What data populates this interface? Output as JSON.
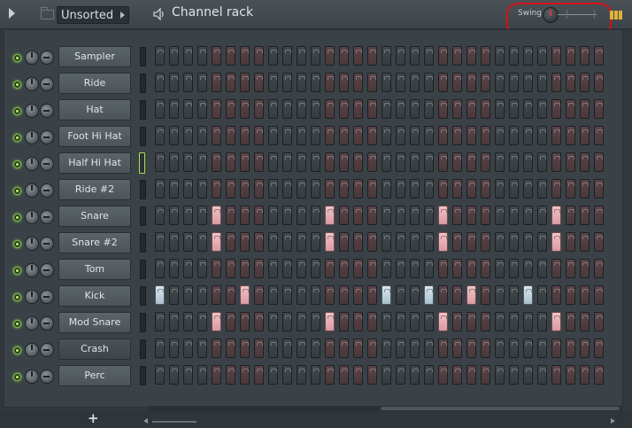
{
  "window": {
    "group_select": "Unsorted",
    "title": "Channel rack",
    "swing_label": "Swing"
  },
  "colors": {
    "background": "#31383d",
    "step_off_gray": "#3b4246",
    "step_off_red": "#503d40",
    "step_on_pink": "#e7b1b7",
    "step_on_blue": "#c3d4df",
    "led": "#8fe24a",
    "highlight": "#d4121a"
  },
  "step_count": 32,
  "channels": [
    {
      "name": "Sampler",
      "active_steps": [],
      "on_color": "pink",
      "selected": false
    },
    {
      "name": "Ride",
      "active_steps": [],
      "on_color": "pink",
      "selected": false
    },
    {
      "name": "Hat",
      "active_steps": [],
      "on_color": "pink",
      "selected": false
    },
    {
      "name": "Foot Hi Hat",
      "active_steps": [],
      "on_color": "pink",
      "selected": false
    },
    {
      "name": "Half Hi Hat",
      "active_steps": [],
      "on_color": "pink",
      "selected": true
    },
    {
      "name": "Ride #2",
      "active_steps": [],
      "on_color": "pink",
      "selected": false
    },
    {
      "name": "Snare",
      "active_steps": [
        5,
        13,
        21,
        29
      ],
      "on_color": "pink",
      "selected": false
    },
    {
      "name": "Snare #2",
      "active_steps": [
        5,
        13,
        21,
        29
      ],
      "on_color": "pink",
      "selected": false
    },
    {
      "name": "Tom",
      "active_steps": [],
      "on_color": "pink",
      "selected": false
    },
    {
      "name": "Kick",
      "active_steps": [
        1,
        7,
        17,
        20,
        23,
        27
      ],
      "on_color": "mixed",
      "selected": false,
      "step_colors": {
        "1": "blue",
        "7": "pink",
        "17": "blue",
        "20": "blue",
        "23": "pink",
        "27": "blue"
      }
    },
    {
      "name": "Mod Snare",
      "active_steps": [
        5,
        13,
        21,
        29
      ],
      "on_color": "pink",
      "selected": false
    },
    {
      "name": "Crash",
      "active_steps": [],
      "on_color": "pink",
      "selected": false
    },
    {
      "name": "Perc",
      "active_steps": [],
      "on_color": "pink",
      "selected": false
    }
  ],
  "add_button_label": "+"
}
